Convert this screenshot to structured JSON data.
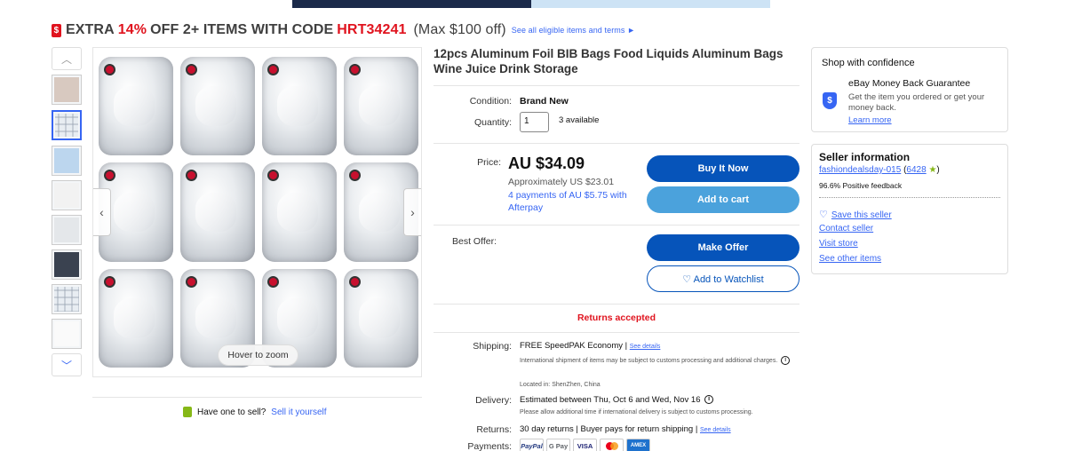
{
  "promo": {
    "prefix": "EXTRA",
    "percent": "14%",
    "middle": "OFF 2+ ITEMS WITH CODE",
    "code": "HRT34241",
    "max": "(Max $100 off)",
    "terms_link": "See all eligible items and terms ►"
  },
  "gallery": {
    "zoom_hint": "Hover to zoom",
    "thumbnail_count": 8,
    "selected_index": 1
  },
  "sell": {
    "question": "Have one to sell?",
    "link": "Sell it yourself"
  },
  "product": {
    "title": "12pcs Aluminum Foil BIB Bags Food Liquids Aluminum Bags Wine Juice Drink Storage",
    "condition_label": "Condition:",
    "condition_value": "Brand New",
    "quantity_label": "Quantity:",
    "quantity_value": "1",
    "available": "3 available",
    "price_label": "Price:",
    "price": "AU $34.09",
    "approx": "Approximately US $23.01",
    "afterpay": "4 payments of AU $5.75 with Afterpay",
    "buy_now": "Buy It Now",
    "add_to_cart": "Add to cart",
    "best_offer_label": "Best Offer:",
    "make_offer": "Make Offer",
    "watchlist": "♡ Add to Watchlist",
    "returns_accepted": "Returns accepted"
  },
  "shipping": {
    "label": "Shipping:",
    "value": "FREE SpeedPAK Economy |",
    "details": "See details",
    "note": "International shipment of items may be subject to customs processing and additional charges.",
    "location": "Located in: ShenZhen, China"
  },
  "delivery": {
    "label": "Delivery:",
    "value": "Estimated between Thu, Oct 6 and Wed, Nov 16",
    "note": "Please allow additional time if international delivery is subject to customs processing."
  },
  "returns": {
    "label": "Returns:",
    "value": "30 day returns | Buyer pays for return shipping |",
    "details": "See details"
  },
  "payments": {
    "label": "Payments:",
    "methods": [
      "PayPal",
      "G Pay",
      "VISA",
      "",
      "AMEX"
    ]
  },
  "confidence": {
    "heading": "Shop with confidence",
    "guarantee_title": "eBay Money Back Guarantee",
    "guarantee_text": "Get the item you ordered or get your money back.",
    "learn_more": "Learn more"
  },
  "seller": {
    "heading": "Seller information",
    "name": "fashiondealsday-015",
    "score": "6428",
    "feedback": "96.6% Positive feedback",
    "save": "Save this seller",
    "contact": "Contact seller",
    "store": "Visit store",
    "other": "See other items"
  },
  "colors": {
    "link": "#3665f3",
    "primary_button": "#0654ba",
    "cart_button": "#4ba2dc",
    "promo_red": "#e0131e"
  }
}
